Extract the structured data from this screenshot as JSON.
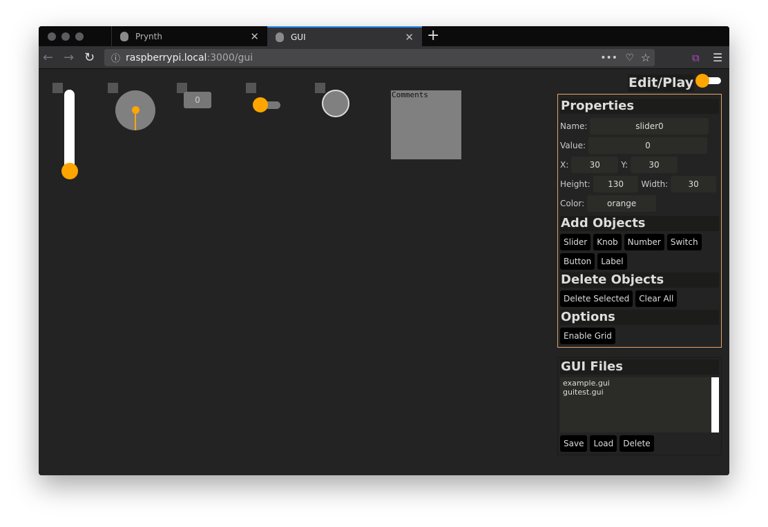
{
  "browser": {
    "tabs": [
      {
        "title": "Prynth",
        "active": false
      },
      {
        "title": "GUI",
        "active": true
      }
    ],
    "url_host": "raspberrypi.local",
    "url_path": ":3000/gui",
    "accent": "#2a8cf0"
  },
  "canvas": {
    "number_value": "0",
    "comments_text": "Comments",
    "slider_value": 0,
    "knob_value": 0,
    "switch_on": false,
    "accent": "#ffa500"
  },
  "header": {
    "mode_label": "Edit/Play",
    "mode_toggle_on": false
  },
  "properties": {
    "title": "Properties",
    "name_label": "Name:",
    "name": "slider0",
    "value_label": "Value:",
    "value": "0",
    "x_label": "X:",
    "x": "30",
    "y_label": "Y:",
    "y": "30",
    "height_label": "Height:",
    "height": "130",
    "width_label": "Width:",
    "width": "30",
    "color_label": "Color:",
    "color": "orange"
  },
  "add_objects": {
    "title": "Add Objects",
    "buttons": [
      "Slider",
      "Knob",
      "Number",
      "Switch",
      "Button",
      "Label"
    ]
  },
  "delete_objects": {
    "title": "Delete Objects",
    "buttons": [
      "Delete Selected",
      "Clear All"
    ]
  },
  "options": {
    "title": "Options",
    "buttons": [
      "Enable Grid"
    ]
  },
  "gui_files": {
    "title": "GUI Files",
    "files": [
      "example.gui",
      "guitest.gui"
    ],
    "buttons": [
      "Save",
      "Load",
      "Delete"
    ]
  }
}
